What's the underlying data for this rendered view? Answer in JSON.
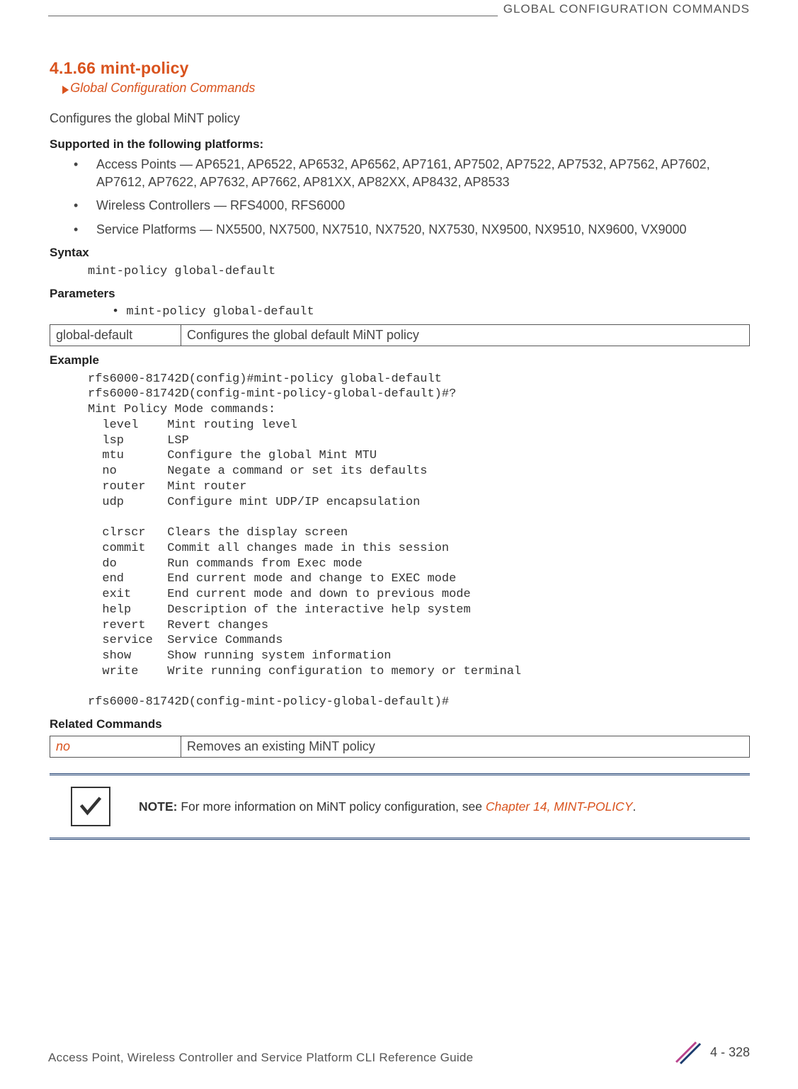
{
  "header": {
    "category": "GLOBAL CONFIGURATION COMMANDS"
  },
  "section": {
    "number_title": "4.1.66 mint-policy",
    "breadcrumb": "Global Configuration Commands",
    "intro": "Configures the global MiNT policy"
  },
  "platforms": {
    "heading": "Supported in the following platforms:",
    "items": [
      "Access Points — AP6521, AP6522, AP6532, AP6562, AP7161, AP7502, AP7522, AP7532, AP7562, AP7602, AP7612, AP7622, AP7632, AP7662, AP81XX, AP82XX, AP8432, AP8533",
      "Wireless Controllers — RFS4000, RFS6000",
      "Service Platforms — NX5500, NX7500, NX7510, NX7520, NX7530, NX9500, NX9510, NX9600, VX9000"
    ]
  },
  "syntax": {
    "heading": "Syntax",
    "code": "mint-policy global-default"
  },
  "parameters": {
    "heading": "Parameters",
    "bullet": "• mint-policy global-default",
    "table": {
      "param": "global-default",
      "desc": "Configures the global default MiNT policy"
    }
  },
  "example": {
    "heading": "Example",
    "code": "rfs6000-81742D(config)#mint-policy global-default\nrfs6000-81742D(config-mint-policy-global-default)#?\nMint Policy Mode commands:\n  level    Mint routing level\n  lsp      LSP\n  mtu      Configure the global Mint MTU\n  no       Negate a command or set its defaults\n  router   Mint router\n  udp      Configure mint UDP/IP encapsulation\n\n  clrscr   Clears the display screen\n  commit   Commit all changes made in this session\n  do       Run commands from Exec mode\n  end      End current mode and change to EXEC mode\n  exit     End current mode and down to previous mode\n  help     Description of the interactive help system\n  revert   Revert changes\n  service  Service Commands\n  show     Show running system information\n  write    Write running configuration to memory or terminal\n\nrfs6000-81742D(config-mint-policy-global-default)#"
  },
  "related": {
    "heading": "Related Commands",
    "cmd": "no",
    "desc": "Removes an existing MiNT policy"
  },
  "note": {
    "label": "NOTE:",
    "text": " For more information on MiNT policy configuration, see ",
    "link": "Chapter 14, MINT-POLICY",
    "suffix": "."
  },
  "footer": {
    "guide": "Access Point, Wireless Controller and Service Platform CLI Reference Guide",
    "page": "4 - 328"
  },
  "chart_data": null
}
